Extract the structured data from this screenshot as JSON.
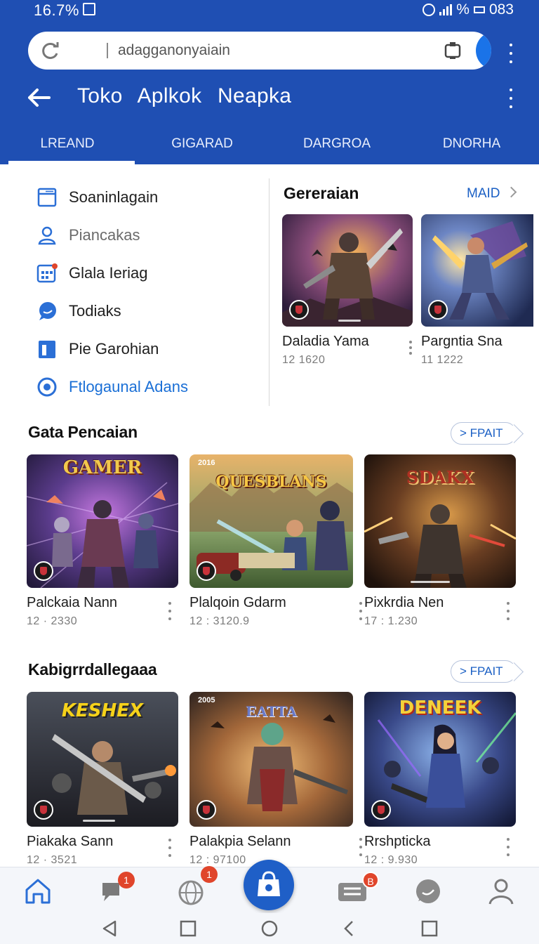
{
  "status_bar": {
    "time": "16.7%",
    "right_text": "%",
    "battery_text": "083"
  },
  "search": {
    "value": "adagganonyaiain"
  },
  "header": {
    "title": "Toko Aplkok Neapka"
  },
  "tabs": [
    {
      "label": "LREAND",
      "active": true
    },
    {
      "label": "GIGARAD",
      "active": false
    },
    {
      "label": "DARGROA",
      "active": false
    },
    {
      "label": "DNORHA",
      "active": false
    }
  ],
  "menu": [
    {
      "label": "Soaninlagain",
      "icon": "window-icon"
    },
    {
      "label": "Piancakas",
      "icon": "person-icon"
    },
    {
      "label": "Glala Ieriag",
      "icon": "grid-calendar-icon"
    },
    {
      "label": "Todiaks",
      "icon": "chat-bubble-icon"
    },
    {
      "label": "Pie Garohian",
      "icon": "bookmark-icon"
    },
    {
      "label": "Ftlogaunal Adans",
      "icon": "radio-target-icon"
    }
  ],
  "featured": {
    "title": "Gereraian",
    "more_label": "MAID",
    "cards": [
      {
        "title": "Daladia Yama",
        "meta": "12 1620"
      },
      {
        "title": "Pargntia Sna",
        "meta": "11 1222"
      }
    ]
  },
  "section1": {
    "title": "Gata Pencaian",
    "more_label": "> FPAIT",
    "cards": [
      {
        "title": "Palckaia Nann",
        "meta": "12 · 2330",
        "art_text": "GAMER"
      },
      {
        "title": "Plalqoin Gdarm",
        "meta": "12 : 3120.9",
        "art_text": "QUESBLANS",
        "corner_text": "2016"
      },
      {
        "title": "Pixkrdia Nen",
        "meta": "17 : 1.230",
        "art_text": "SDAKX"
      }
    ]
  },
  "section2": {
    "title": "Kabigrrdallegaaa",
    "more_label": "> FPAIT",
    "cards": [
      {
        "title": "Piakaka Sann",
        "meta": "12 · 3521",
        "art_text": "KESHEX"
      },
      {
        "title": "Palakpia Selann",
        "meta": "12 : 97100",
        "art_text": "EATTA",
        "corner_text": "2005"
      },
      {
        "title": "Rrshpticka",
        "meta": "12 : 9.930",
        "art_text": "DENEEK"
      }
    ]
  },
  "bottom_nav": {
    "badges": {
      "chat": "1",
      "globe": "1",
      "list": "B"
    }
  }
}
